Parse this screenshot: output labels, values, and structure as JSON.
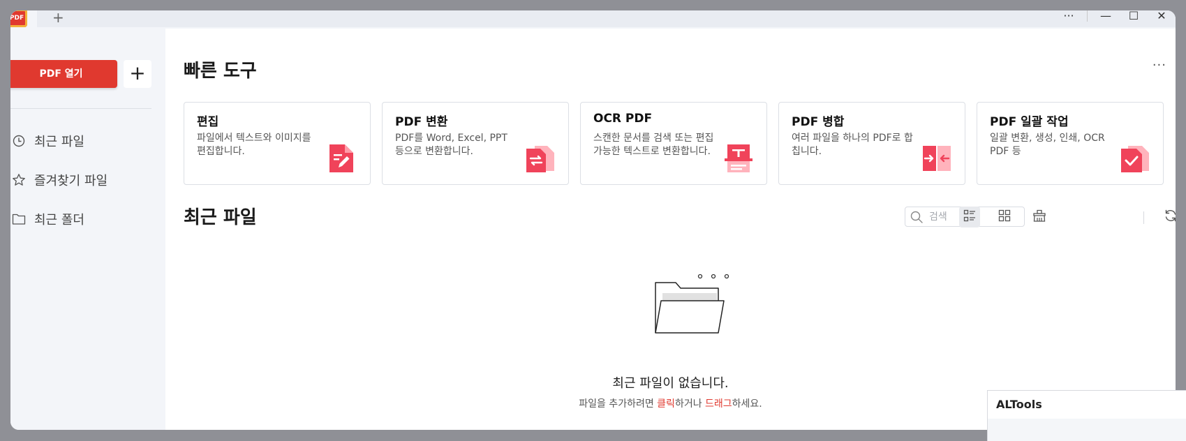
{
  "titlebar": {
    "app_icon_text": "PDF",
    "new_tab": "+",
    "more": "···",
    "minimize": "—",
    "maximize": "☐",
    "close": "✕"
  },
  "sidebar": {
    "open_pdf": "PDF 열기",
    "add": "+",
    "items": [
      {
        "label": "최근 파일",
        "icon": "clock-icon"
      },
      {
        "label": "즐겨찾기 파일",
        "icon": "star-icon"
      },
      {
        "label": "최근 폴더",
        "icon": "folder-icon"
      }
    ]
  },
  "quick_tools": {
    "title": "빠른 도구",
    "more": "···",
    "cards": [
      {
        "title": "편집",
        "desc": "파일에서 텍스트와 이미지를 편집합니다.",
        "icon": "edit-pdf-icon"
      },
      {
        "title": "PDF 변환",
        "desc": "PDF를 Word, Excel, PPT 등으로 변환합니다.",
        "icon": "convert-pdf-icon"
      },
      {
        "title": "OCR PDF",
        "desc": "스캔한 문서를 검색 또는 편집 가능한 텍스트로 변환합니다.",
        "icon": "ocr-pdf-icon"
      },
      {
        "title": "PDF 병합",
        "desc": "여러 파일을 하나의 PDF로 합칩니다.",
        "icon": "merge-pdf-icon"
      },
      {
        "title": "PDF 일괄 작업",
        "desc": "일괄 변환, 생성, 인쇄, OCR PDF 등",
        "icon": "batch-pdf-icon"
      }
    ]
  },
  "recent": {
    "title": "최근 파일",
    "search_placeholder": "검색",
    "empty_title": "최근 파일이 없습니다.",
    "empty_sub_1": "파일을 추가하려면 ",
    "empty_link_1": "클릭",
    "empty_sub_2": "하거나 ",
    "empty_link_2": "드래그",
    "empty_sub_3": "하세요."
  },
  "altools": {
    "title": "ALTools"
  },
  "colors": {
    "accent": "#e0392f",
    "icon_pink": "#f0435a",
    "sidebar_bg": "#f3f5f9"
  }
}
